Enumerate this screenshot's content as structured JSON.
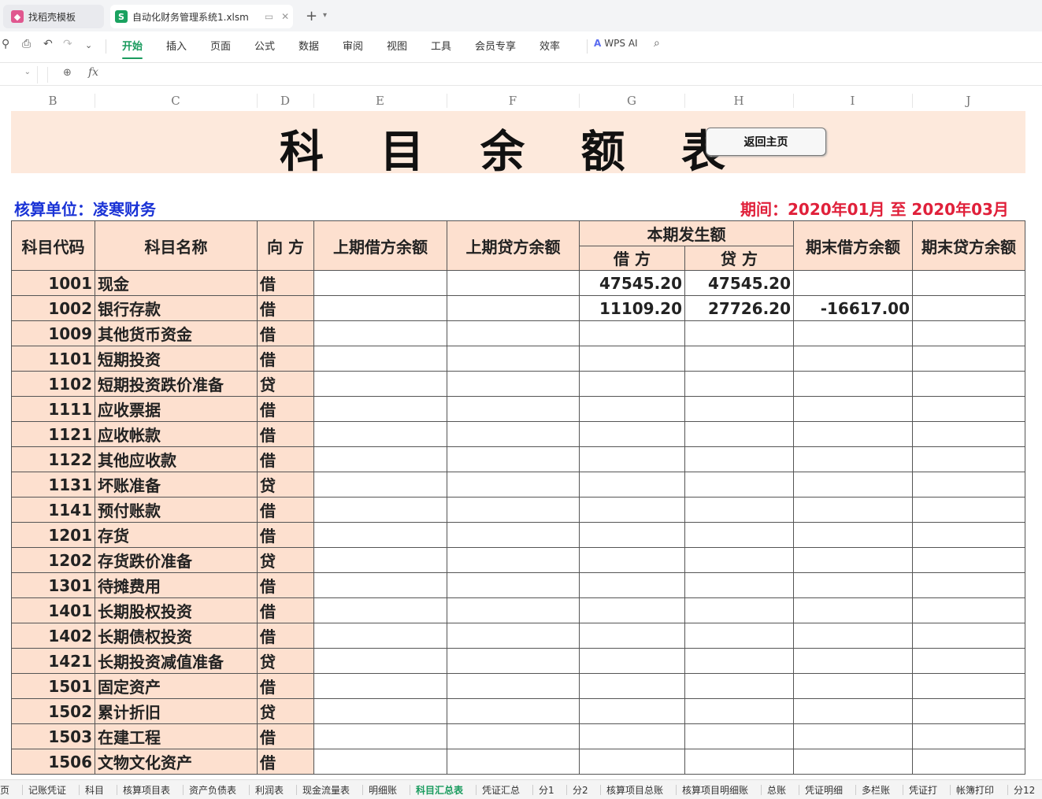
{
  "tabs": [
    {
      "label": "找稻壳模板"
    },
    {
      "label": "自动化财务管理系统1.xlsm"
    }
  ],
  "ribbon": {
    "items": [
      "开始",
      "插入",
      "页面",
      "公式",
      "数据",
      "审阅",
      "视图",
      "工具",
      "会员专享",
      "效率"
    ],
    "active": "开始",
    "ai_label": "WPS AI"
  },
  "formula": {
    "fx": "fx"
  },
  "columns": [
    "B",
    "C",
    "D",
    "E",
    "F",
    "G",
    "H",
    "I",
    "J"
  ],
  "sheet": {
    "title": "科 目 余 额 表",
    "home_button": "返回主页",
    "unit": "核算单位：凌寒财务",
    "period": "期间：2020年01月 至 2020年03月",
    "headers": {
      "code": "科目代码",
      "name": "科目名称",
      "direction": "向 方",
      "prev_debit": "上期借方余额",
      "prev_credit": "上期贷方余额",
      "current": "本期发生额",
      "cur_debit": "借 方",
      "cur_credit": "贷 方",
      "end_debit": "期末借方余额",
      "end_credit": "期末贷方余额"
    },
    "rows": [
      {
        "code": "1001",
        "name": "现金",
        "dir": "借",
        "prev_debit": "",
        "prev_credit": "",
        "debit": "47545.20",
        "credit": "47545.20",
        "end_debit": "",
        "end_credit": ""
      },
      {
        "code": "1002",
        "name": "银行存款",
        "dir": "借",
        "prev_debit": "",
        "prev_credit": "",
        "debit": "11109.20",
        "credit": "27726.20",
        "end_debit": "-16617.00",
        "end_credit": ""
      },
      {
        "code": "1009",
        "name": "其他货币资金",
        "dir": "借",
        "prev_debit": "",
        "prev_credit": "",
        "debit": "",
        "credit": "",
        "end_debit": "",
        "end_credit": ""
      },
      {
        "code": "1101",
        "name": "短期投资",
        "dir": "借",
        "prev_debit": "",
        "prev_credit": "",
        "debit": "",
        "credit": "",
        "end_debit": "",
        "end_credit": ""
      },
      {
        "code": "1102",
        "name": "短期投资跌价准备",
        "dir": "贷",
        "prev_debit": "",
        "prev_credit": "",
        "debit": "",
        "credit": "",
        "end_debit": "",
        "end_credit": ""
      },
      {
        "code": "1111",
        "name": "应收票据",
        "dir": "借",
        "prev_debit": "",
        "prev_credit": "",
        "debit": "",
        "credit": "",
        "end_debit": "",
        "end_credit": ""
      },
      {
        "code": "1121",
        "name": "应收帐款",
        "dir": "借",
        "prev_debit": "",
        "prev_credit": "",
        "debit": "",
        "credit": "",
        "end_debit": "",
        "end_credit": ""
      },
      {
        "code": "1122",
        "name": "其他应收款",
        "dir": "借",
        "prev_debit": "",
        "prev_credit": "",
        "debit": "",
        "credit": "",
        "end_debit": "",
        "end_credit": ""
      },
      {
        "code": "1131",
        "name": "坏账准备",
        "dir": "贷",
        "prev_debit": "",
        "prev_credit": "",
        "debit": "",
        "credit": "",
        "end_debit": "",
        "end_credit": ""
      },
      {
        "code": "1141",
        "name": "预付账款",
        "dir": "借",
        "prev_debit": "",
        "prev_credit": "",
        "debit": "",
        "credit": "",
        "end_debit": "",
        "end_credit": ""
      },
      {
        "code": "1201",
        "name": "存货",
        "dir": "借",
        "prev_debit": "",
        "prev_credit": "",
        "debit": "",
        "credit": "",
        "end_debit": "",
        "end_credit": ""
      },
      {
        "code": "1202",
        "name": "存货跌价准备",
        "dir": "贷",
        "prev_debit": "",
        "prev_credit": "",
        "debit": "",
        "credit": "",
        "end_debit": "",
        "end_credit": ""
      },
      {
        "code": "1301",
        "name": "待摊费用",
        "dir": "借",
        "prev_debit": "",
        "prev_credit": "",
        "debit": "",
        "credit": "",
        "end_debit": "",
        "end_credit": ""
      },
      {
        "code": "1401",
        "name": "长期股权投资",
        "dir": "借",
        "prev_debit": "",
        "prev_credit": "",
        "debit": "",
        "credit": "",
        "end_debit": "",
        "end_credit": ""
      },
      {
        "code": "1402",
        "name": "长期债权投资",
        "dir": "借",
        "prev_debit": "",
        "prev_credit": "",
        "debit": "",
        "credit": "",
        "end_debit": "",
        "end_credit": ""
      },
      {
        "code": "1421",
        "name": "长期投资减值准备",
        "dir": "贷",
        "prev_debit": "",
        "prev_credit": "",
        "debit": "",
        "credit": "",
        "end_debit": "",
        "end_credit": ""
      },
      {
        "code": "1501",
        "name": "固定资产",
        "dir": "借",
        "prev_debit": "",
        "prev_credit": "",
        "debit": "",
        "credit": "",
        "end_debit": "",
        "end_credit": ""
      },
      {
        "code": "1502",
        "name": "累计折旧",
        "dir": "贷",
        "prev_debit": "",
        "prev_credit": "",
        "debit": "",
        "credit": "",
        "end_debit": "",
        "end_credit": ""
      },
      {
        "code": "1503",
        "name": "在建工程",
        "dir": "借",
        "prev_debit": "",
        "prev_credit": "",
        "debit": "",
        "credit": "",
        "end_debit": "",
        "end_credit": ""
      },
      {
        "code": "1506",
        "name": "文物文化资产",
        "dir": "借",
        "prev_debit": "",
        "prev_credit": "",
        "debit": "",
        "credit": "",
        "end_debit": "",
        "end_credit": ""
      }
    ]
  },
  "sheet_tabs": [
    "页",
    "记账凭证",
    "科目",
    "核算项目表",
    "资产负债表",
    "利润表",
    "现金流量表",
    "明细账",
    "科目汇总表",
    "凭证汇总",
    "分1",
    "分2",
    "核算项目总账",
    "核算项目明细账",
    "总账",
    "凭证明细",
    "多栏账",
    "凭证打",
    "帐簿打印",
    "分12"
  ],
  "active_sheet_tab": "科目汇总表",
  "colors": {
    "accent": "#1a9b5e",
    "unit": "#1a33d6",
    "period": "#e0203a",
    "header_fill": "#fde0cf"
  }
}
